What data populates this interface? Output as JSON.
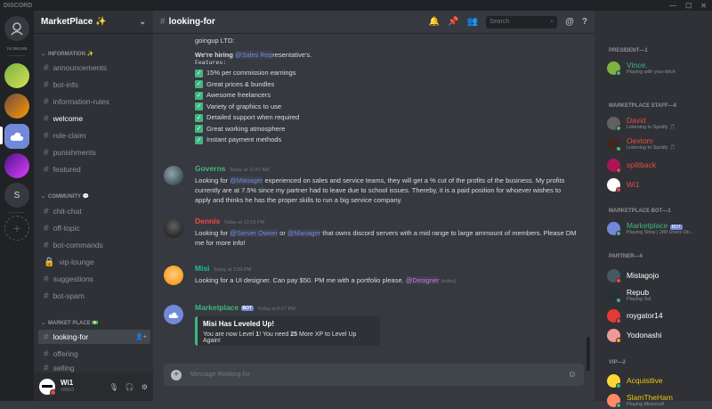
{
  "app_title": "DISCORD",
  "guilds": {
    "online_label": "74 ONLINE"
  },
  "server": {
    "name": "MarketPlace ✨"
  },
  "categories": [
    {
      "label": "INFORMATION ✨"
    },
    {
      "label": "COMMUNITY 💬"
    },
    {
      "label": "MARKET PLACE 💵"
    }
  ],
  "channels": [
    {
      "name": "announcements"
    },
    {
      "name": "bot-info"
    },
    {
      "name": "information-rules"
    },
    {
      "name": "welcome"
    },
    {
      "name": "role-claim"
    },
    {
      "name": "punishments"
    },
    {
      "name": "featured"
    },
    {
      "name": "chit-chat"
    },
    {
      "name": "off-topic"
    },
    {
      "name": "bot-commands"
    },
    {
      "name": "vip-lounge"
    },
    {
      "name": "suggestions"
    },
    {
      "name": "bot-spam"
    },
    {
      "name": "looking-for"
    },
    {
      "name": "offering"
    },
    {
      "name": "selling"
    }
  ],
  "user": {
    "name": "Wi1",
    "tag": "#8893"
  },
  "header": {
    "channel": "looking-for",
    "search_placeholder": "Search"
  },
  "messages": {
    "m1": {
      "intro": "goingup LTD:",
      "hiring_prefix": "We're hiring ",
      "hiring_mention": "@Sales Rep",
      "hiring_suffix": "resentative's.",
      "features_label": "Features:",
      "features": [
        "15% per commission earnings",
        "Great prices & bundles",
        "Awesome freelancers",
        "Variety of graphics to use",
        "Detailed support when required",
        "Great working atmosphere",
        "Instant payment methods"
      ]
    },
    "m2": {
      "author": "Governs",
      "time": "Today at 11:47 AM",
      "p1": "Looking for ",
      "mention": "@Manager",
      "p2": " experienced on sales and service teams, they will get a % cut of the profits of the business. My profits currently are at 7.5% since my partner had to leave due to school issues. Thereby, it is a paid position for whoever wishes to apply and thinks he has the proper skills to run a big service company."
    },
    "m3": {
      "author": "Dennis",
      "time": "Today at 12:19 PM",
      "p1": "Looking for ",
      "mention1": "@Server Owner",
      "p2": " or ",
      "mention2": "@Manager",
      "p3": " that owns discord servers with a mid range to large ammount of members. Please DM me for more info!"
    },
    "m4": {
      "author": "Misi",
      "time": "Today at 3:50 PM",
      "p1": "Looking for a UI designer. Can pay $50. PM me with a portfolio please. ",
      "mention": "@Designer",
      "edited": "(edited)"
    },
    "m5": {
      "author": "Marketplace",
      "bot_tag": "BOT",
      "time": "Today at 5:27 PM",
      "embed_title": "Misi Has Leveled Up!",
      "e1": "You are now Level ",
      "level": "1",
      "e2": "! You need ",
      "xp": "25",
      "e3": " More XP to Level Up Again!"
    }
  },
  "composer": {
    "placeholder": "Message #looking-for"
  },
  "members": {
    "categories": [
      {
        "label": "PRESIDENT—1"
      },
      {
        "label": "MARKETPLACE STAFF—4"
      },
      {
        "label": "MARKETPLACE BOT—1"
      },
      {
        "label": "PARTNER—4"
      },
      {
        "label": "VIP—2"
      }
    ],
    "list": [
      {
        "name": "Vince.",
        "status": "Playing with your bitch",
        "color": "#43b581"
      },
      {
        "name": "David",
        "status": "Listening to Spotify 🎵",
        "color": "#e74c3c"
      },
      {
        "name": "Oextom",
        "status": "Listening to Spotify 🎵",
        "color": "#e74c3c"
      },
      {
        "name": "spiltback",
        "status": "",
        "color": "#e74c3c"
      },
      {
        "name": "Wi1",
        "status": "",
        "color": "#e74c3c"
      },
      {
        "name": "Marketplace",
        "bot": "BOT",
        "status": "Playing Shop | 289 Users On...",
        "color": "#43b581"
      },
      {
        "name": "Mistagojo",
        "status": "",
        "color": "#ffffff"
      },
      {
        "name": "Repub",
        "status": "Playing Sol",
        "color": "#ffffff"
      },
      {
        "name": "roygator14",
        "status": "",
        "color": "#ffffff"
      },
      {
        "name": "Yodonashi",
        "status": "",
        "color": "#ffffff"
      },
      {
        "name": "Acquisitive",
        "status": "",
        "color": "#f1c40f"
      },
      {
        "name": "SlamTheHam",
        "status": "Playing Minecraft",
        "color": "#f1c40f"
      }
    ]
  },
  "colors": {
    "accent": "#7289da",
    "online": "#43b581",
    "dnd": "#f04747",
    "idle": "#faa61a"
  }
}
